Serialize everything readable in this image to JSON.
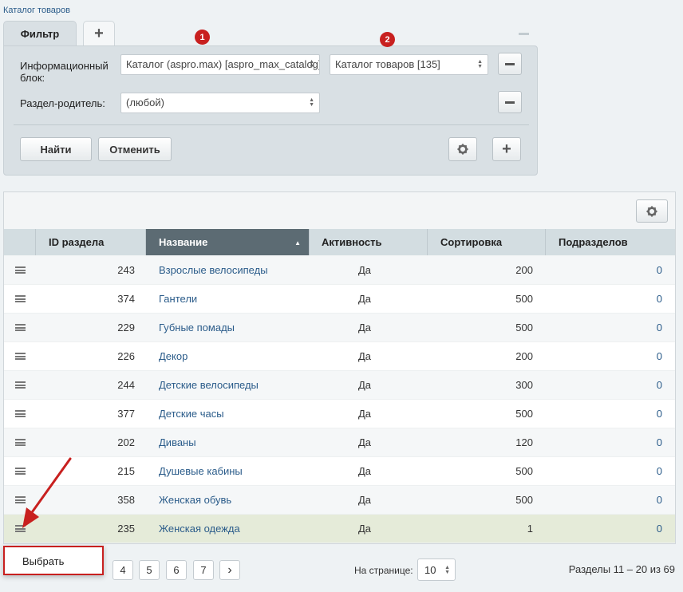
{
  "breadcrumb": "Каталог товаров",
  "filter": {
    "tab_label": "Фильтр",
    "add_tab_symbol": "+",
    "rows": [
      {
        "label": "Информационный блок:",
        "select1": "Каталог (aspro.max) [aspro_max_catalog]",
        "select2": "Каталог товаров [135]"
      },
      {
        "label": "Раздел-родитель:",
        "select1": "(любой)"
      }
    ],
    "find_button": "Найти",
    "cancel_button": "Отменить",
    "add_symbol": "+"
  },
  "annotations": {
    "badge1": "1",
    "badge2": "2"
  },
  "table": {
    "columns": [
      "ID раздела",
      "Название",
      "Активность",
      "Сортировка",
      "Подразделов"
    ],
    "sorted_arrow": "▲",
    "rows": [
      {
        "id": "243",
        "name": "Взрослые велосипеды",
        "active": "Да",
        "sort": "200",
        "count": "0"
      },
      {
        "id": "374",
        "name": "Гантели",
        "active": "Да",
        "sort": "500",
        "count": "0"
      },
      {
        "id": "229",
        "name": "Губные помады",
        "active": "Да",
        "sort": "500",
        "count": "0"
      },
      {
        "id": "226",
        "name": "Декор",
        "active": "Да",
        "sort": "200",
        "count": "0"
      },
      {
        "id": "244",
        "name": "Детские велосипеды",
        "active": "Да",
        "sort": "300",
        "count": "0"
      },
      {
        "id": "377",
        "name": "Детские часы",
        "active": "Да",
        "sort": "500",
        "count": "0"
      },
      {
        "id": "202",
        "name": "Диваны",
        "active": "Да",
        "sort": "120",
        "count": "0"
      },
      {
        "id": "215",
        "name": "Душевые кабины",
        "active": "Да",
        "sort": "500",
        "count": "0"
      },
      {
        "id": "358",
        "name": "Женская обувь",
        "active": "Да",
        "sort": "500",
        "count": "0"
      },
      {
        "id": "235",
        "name": "Женская одежда",
        "active": "Да",
        "sort": "1",
        "count": "0"
      }
    ]
  },
  "pagination": {
    "pages": [
      "4",
      "5",
      "6",
      "7"
    ],
    "next_symbol": "›",
    "per_page_label": "На странице:",
    "per_page_value": "10",
    "summary": "Разделы 11 – 20 из 69"
  },
  "context_menu": {
    "select_label": "Выбрать"
  },
  "colors": {
    "accent_red": "#c8201f",
    "link_blue": "#2b5c8a",
    "sorted_header": "#5c6b73"
  }
}
